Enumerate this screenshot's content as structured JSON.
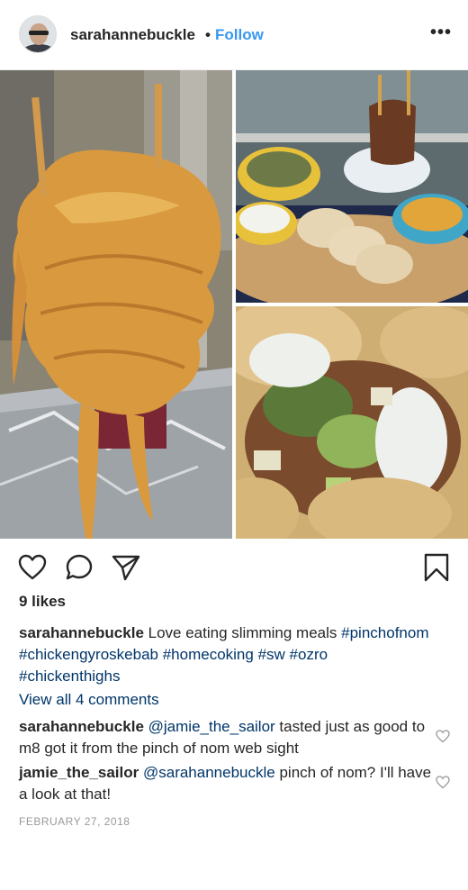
{
  "post": {
    "username": "sarahannebuckle",
    "separator": "•",
    "follow_label": "Follow",
    "more_label": "•••"
  },
  "icons": {
    "like": "heart-icon",
    "comment": "comment-icon",
    "share": "send-icon",
    "save": "bookmark-icon",
    "comment_like": "heart-icon"
  },
  "likes": "9 likes",
  "caption": {
    "username": "sarahannebuckle",
    "text": "Love eating slimming meals",
    "hashtags": [
      "#pinchofnom",
      "#chickengyroskebab",
      "#homecoking",
      "#sw",
      "#ozro",
      "#chickenthighs"
    ]
  },
  "view_all_comments": "View all 4 comments",
  "comments": [
    {
      "username": "sarahannebuckle",
      "mention": "@jamie_the_sailor",
      "text": "tasted just as good to m8 got it from the pinch of nom web sight"
    },
    {
      "username": "jamie_the_sailor",
      "mention": "@sarahannebuckle",
      "text": "pinch of nom? I'll have a look at that!"
    }
  ],
  "date": "FEBRUARY 27, 2018",
  "colors": {
    "link": "#3897f0",
    "hashtag": "#003569",
    "text": "#262626",
    "muted": "#999999"
  }
}
